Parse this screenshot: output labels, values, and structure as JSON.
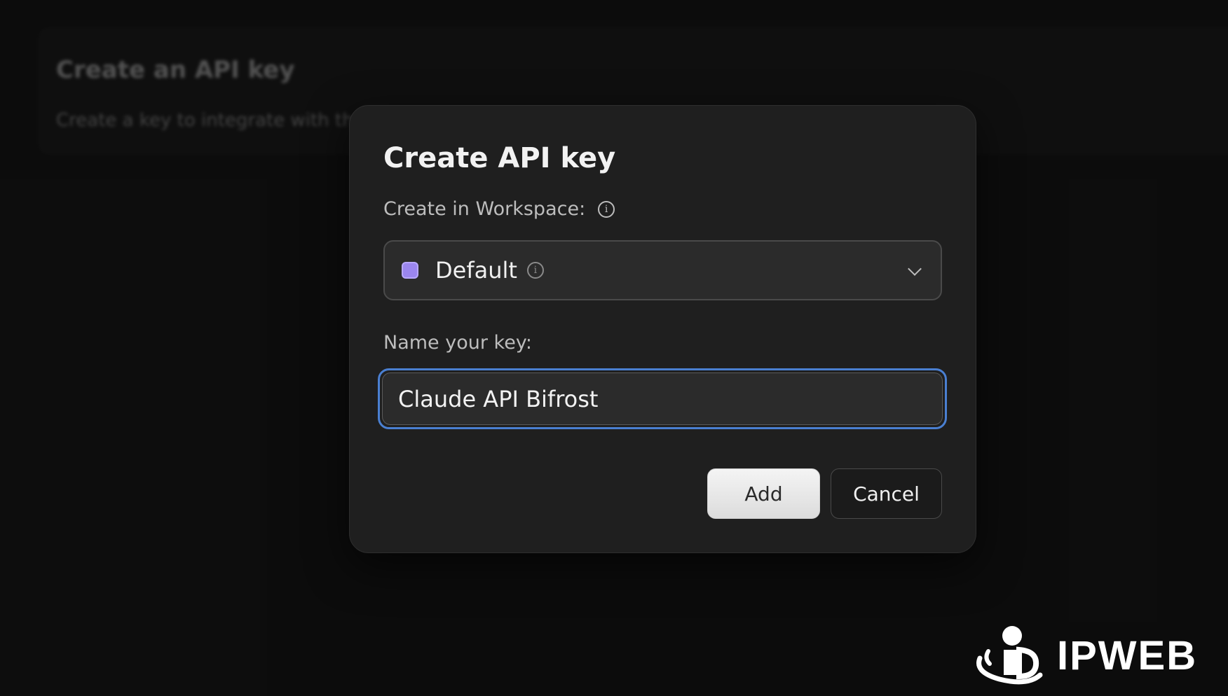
{
  "background": {
    "title": "Create an API key",
    "subtitle": "Create a key to integrate with th"
  },
  "modal": {
    "title": "Create API key",
    "workspace_label": "Create in Workspace:",
    "workspace_info_icon": "info-icon",
    "workspace_select": {
      "value": "Default",
      "swatch_color": "#9b86ef",
      "info_icon": "info-icon",
      "chevron_icon": "chevron-down-icon"
    },
    "name_label": "Name your key:",
    "name_input_value": "Claude API Bifrost",
    "add_label": "Add",
    "cancel_label": "Cancel",
    "focus_ring_color": "#4a7fd1"
  },
  "watermark": {
    "text": "IPWEB"
  }
}
